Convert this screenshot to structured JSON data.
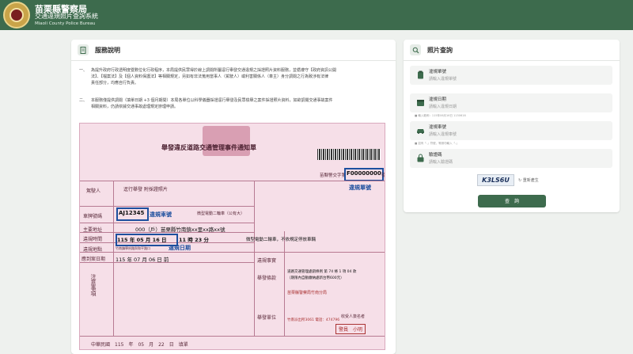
{
  "header": {
    "title": "苗栗縣警察局",
    "subtitle": "交通違規照片查詢系統",
    "subtitle_en": "Miaoli County Police Bureau"
  },
  "service": {
    "title": "服務說明",
    "item1_num": "一、",
    "item1_line1": "為提升政府行政透明度暨數位化行政程序，本局提供民眾得於線上調閱所屬逕行舉發交通違規之採證照片資料服務，並循遵守【政府資訊公開",
    "item1_line2": "法】、【檔案法】及【個人資料保護法】等相關規定，另如有非法蒐用當事人（駕駛人）或利害關係人（車主）身分調閱之行為致涉有法律",
    "item1_line3": "責任部分，均應自行負責。",
    "item2_num": "二、",
    "item2_line1": "本服務僅提供調閱（填單日期 +3 個月期間）本局各單位以科學儀器採證逕行舉發及民眾檢舉之案件採證照片資料，如欲調閱交通事故案件",
    "item2_line2": "相關資料，仍請依據交通事故處理規定辦理申請。"
  },
  "ticket": {
    "title": "舉發違反道路交通管理事件通知單",
    "case_label": "苗縣警交字第",
    "case_number": "F00000000",
    "case_suffix": "號",
    "case_annotation": "違規單號",
    "plate": "AJ12345",
    "plate_annotation": "違規車號",
    "date": "115 年 05 月 16 日",
    "time": "11 時 23 分",
    "date_annotation": "違規日期",
    "row_driver": "駕駛人",
    "row_photo": "逕行舉發\n附採證照片",
    "row_plate": "車牌號碼",
    "row_vehicle": "微型電動二輪車（公有大）",
    "row_address": "主要地址",
    "address_value": "000（戶）苗栗縣竹南鎮xx里xx路xx號",
    "row_time": "違規時間",
    "row_place": "違規地點",
    "place_value": "竹南鎮學府路與和平路口",
    "row_deadline": "應到案日期",
    "deadline_value": "115 年 07 月 06 日 前",
    "facts_label": "違規事實",
    "facts_value": "微型電動二輪車，不依規定停放車輛",
    "law_label": "舉發條款",
    "law_value": "道路交通管理處罰條例 第 74 條 1 項 04 款",
    "penalty_value": "（期限內自動繳納處新台幣600元）",
    "notice_label": "注意事項",
    "unit_label": "舉發單位",
    "unit_value": "苗栗縣警察局竹南分局",
    "recipient_label": "收受人簽名者",
    "officer": "警員　小明",
    "footer_date": "中華民國　115　年　05　月　22　日　填單",
    "stamp_text": "竹南派出所3061 電話：474796"
  },
  "query": {
    "title": "照片查詢",
    "fields": [
      {
        "label": "違規單號",
        "placeholder": "請輸入違規單號",
        "icon": "clipboard-icon"
      },
      {
        "label": "違規日期",
        "placeholder": "請輸入違規日期",
        "icon": "calendar-icon"
      },
      {
        "label": "違規車號",
        "placeholder": "請輸入違規車號",
        "icon": "car-icon"
      },
      {
        "label": "驗證碼",
        "placeholder": "請輸入驗證碼",
        "icon": "lock-icon"
      }
    ],
    "date_hint": "■ 輸入範例：115年06月16日 1150616",
    "plate_hint": "■ 如有「-」符號，等請勿輸入「-」",
    "captcha": "K3LS6U",
    "refresh": "重新產生",
    "submit": "查　詢"
  },
  "colors": {
    "brand": "#3d6b4d",
    "annotation": "#1d4f9e",
    "ticket_bg": "#f6dfe8"
  }
}
